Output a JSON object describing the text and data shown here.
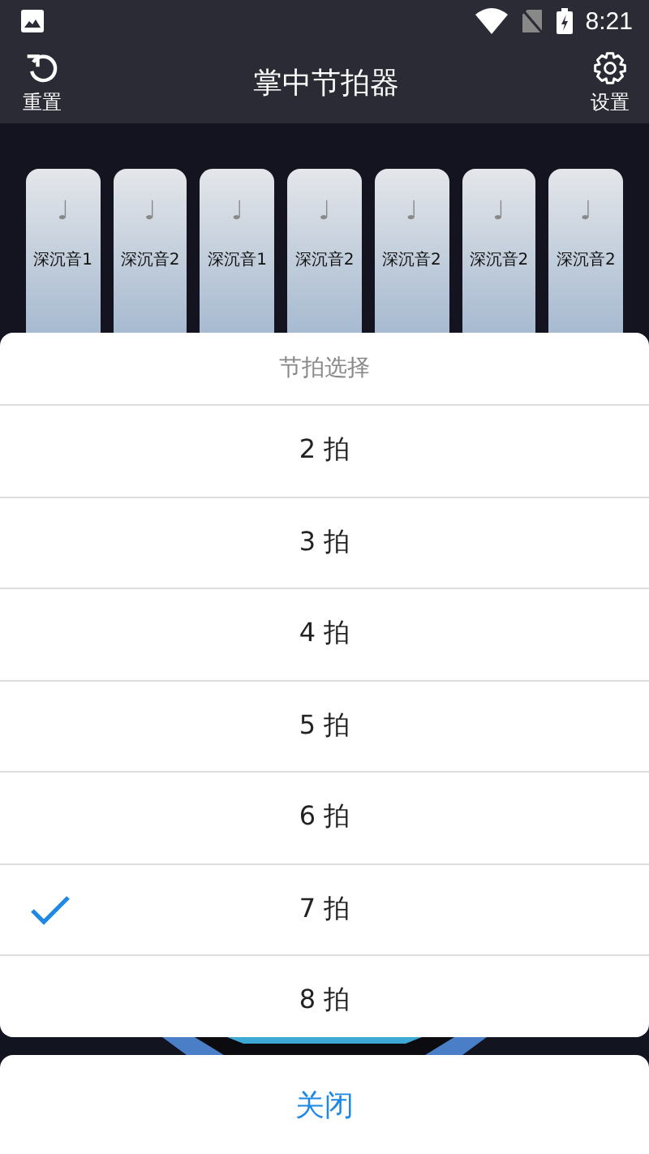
{
  "status_bar": {
    "time": "8:21"
  },
  "toolbar": {
    "title": "掌中节拍器",
    "left_button": {
      "label": "重置"
    },
    "right_button": {
      "label": "设置"
    }
  },
  "beat_pads": [
    {
      "note": "♩",
      "label": "深沉音1"
    },
    {
      "note": "♩",
      "label": "深沉音2"
    },
    {
      "note": "♩",
      "label": "深沉音1"
    },
    {
      "note": "♩",
      "label": "深沉音2"
    },
    {
      "note": "♩",
      "label": "深沉音2"
    },
    {
      "note": "♩",
      "label": "深沉音2"
    },
    {
      "note": "♩",
      "label": "深沉音2"
    }
  ],
  "sheet": {
    "title": "节拍选择",
    "options": [
      {
        "label": "2 拍",
        "selected": false
      },
      {
        "label": "3 拍",
        "selected": false
      },
      {
        "label": "4 拍",
        "selected": false
      },
      {
        "label": "5 拍",
        "selected": false
      },
      {
        "label": "6 拍",
        "selected": false
      },
      {
        "label": "7 拍",
        "selected": true
      },
      {
        "label": "8 拍",
        "selected": false
      }
    ],
    "close_button": "关闭"
  }
}
